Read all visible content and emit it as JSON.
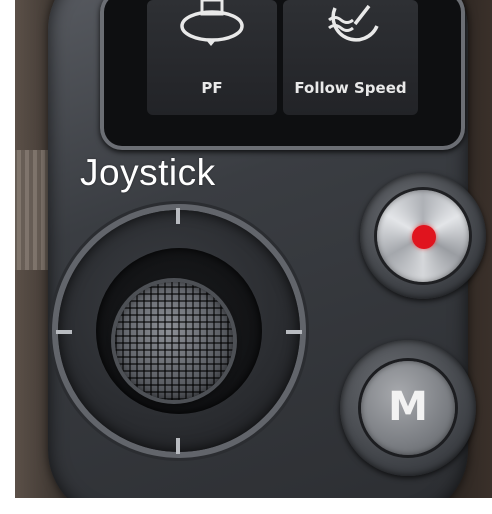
{
  "photo_label": "Joystick",
  "screen": {
    "tiles": [
      {
        "label": "PF",
        "icon": "pf-rotation-icon"
      },
      {
        "label": "Follow Speed",
        "icon": "follow-speed-icon"
      }
    ]
  },
  "buttons": {
    "record": {
      "icon": "record-dot-icon",
      "color": "#e0141e"
    },
    "mode": {
      "label": "M"
    }
  },
  "colors": {
    "device_body": "#3a3d42",
    "record_red": "#e0141e",
    "label_text": "#ffffff"
  }
}
